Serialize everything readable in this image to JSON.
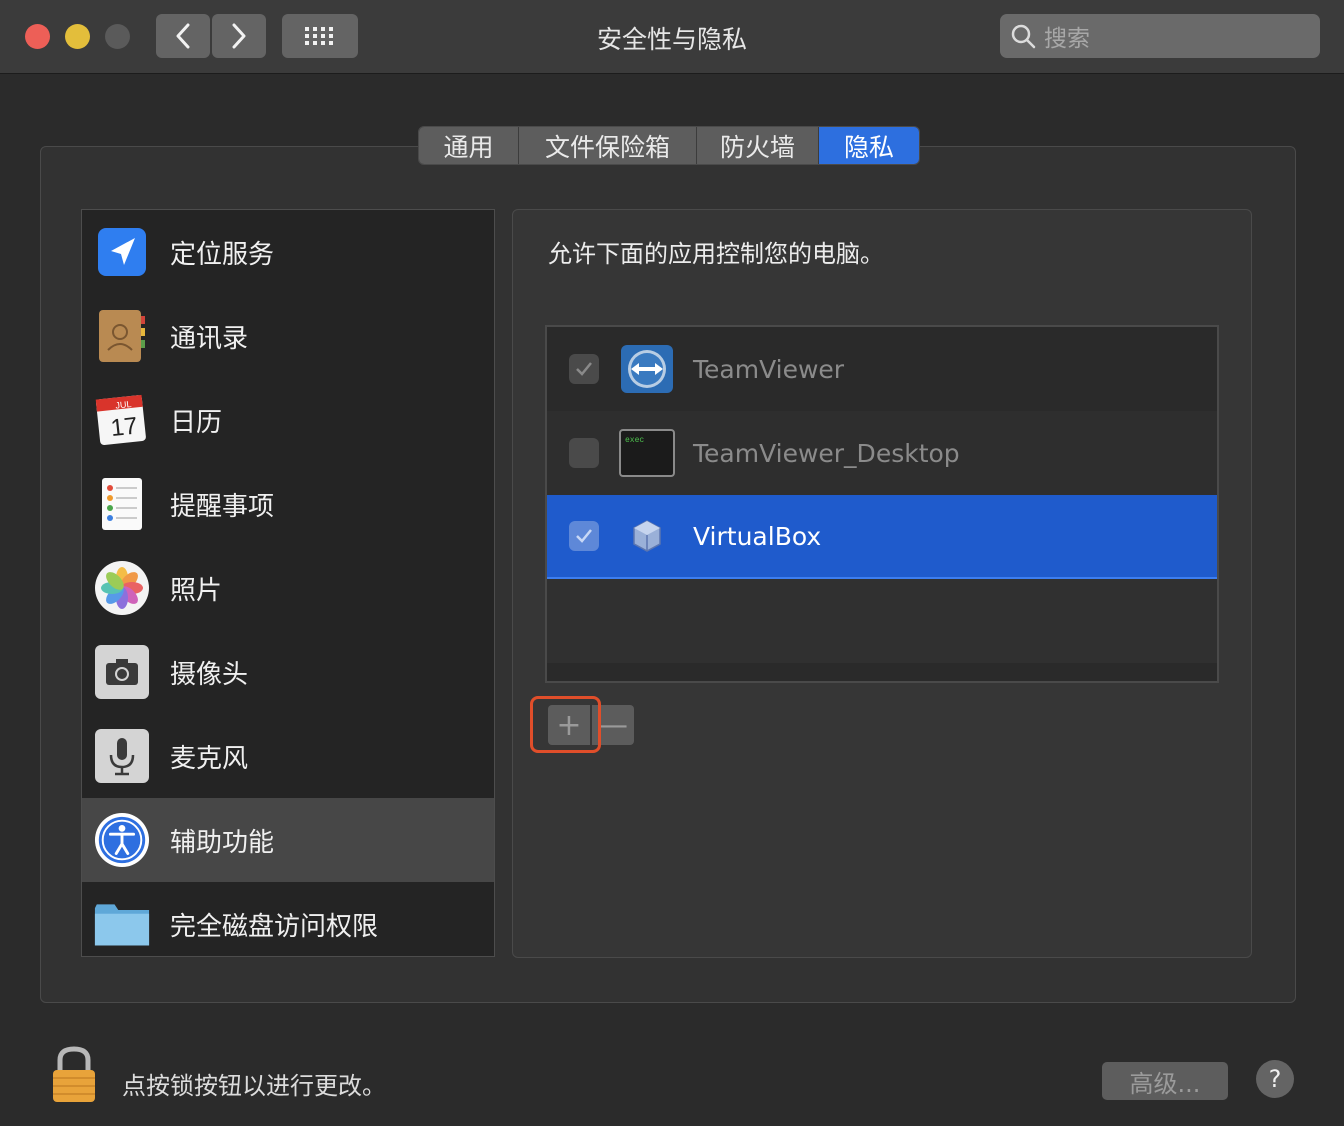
{
  "window": {
    "title": "安全性与隐私",
    "search_placeholder": "搜索"
  },
  "tabs": [
    {
      "label": "通用",
      "active": false
    },
    {
      "label": "文件保险箱",
      "active": false
    },
    {
      "label": "防火墙",
      "active": false
    },
    {
      "label": "隐私",
      "active": true
    }
  ],
  "sidebar": {
    "items": [
      {
        "label": "定位服务",
        "icon": "location-arrow-icon"
      },
      {
        "label": "通讯录",
        "icon": "contacts-book-icon"
      },
      {
        "label": "日历",
        "icon": "calendar-icon",
        "month": "JUL",
        "day": "17"
      },
      {
        "label": "提醒事项",
        "icon": "reminders-icon"
      },
      {
        "label": "照片",
        "icon": "photos-icon"
      },
      {
        "label": "摄像头",
        "icon": "camera-icon"
      },
      {
        "label": "麦克风",
        "icon": "microphone-icon"
      },
      {
        "label": "辅助功能",
        "icon": "accessibility-icon",
        "selected": true
      },
      {
        "label": "完全磁盘访问权限",
        "icon": "folder-icon"
      }
    ]
  },
  "content": {
    "description": "允许下面的应用控制您的电脑。",
    "apps": [
      {
        "name": "TeamViewer",
        "checked": true,
        "icon": "teamviewer-icon"
      },
      {
        "name": "TeamViewer_Desktop",
        "checked": false,
        "icon": "exec-terminal-icon",
        "icon_text": "exec"
      },
      {
        "name": "VirtualBox",
        "checked": true,
        "icon": "virtualbox-icon",
        "selected": true
      }
    ],
    "add_label": "+",
    "remove_label": "—"
  },
  "footer": {
    "lock_text": "点按锁按钮以进行更改。",
    "advanced_label": "高级...",
    "help_label": "?"
  },
  "colors": {
    "accent": "#2d6fdf",
    "selection": "#1f5bcc",
    "highlight_box": "#e04e2a"
  }
}
